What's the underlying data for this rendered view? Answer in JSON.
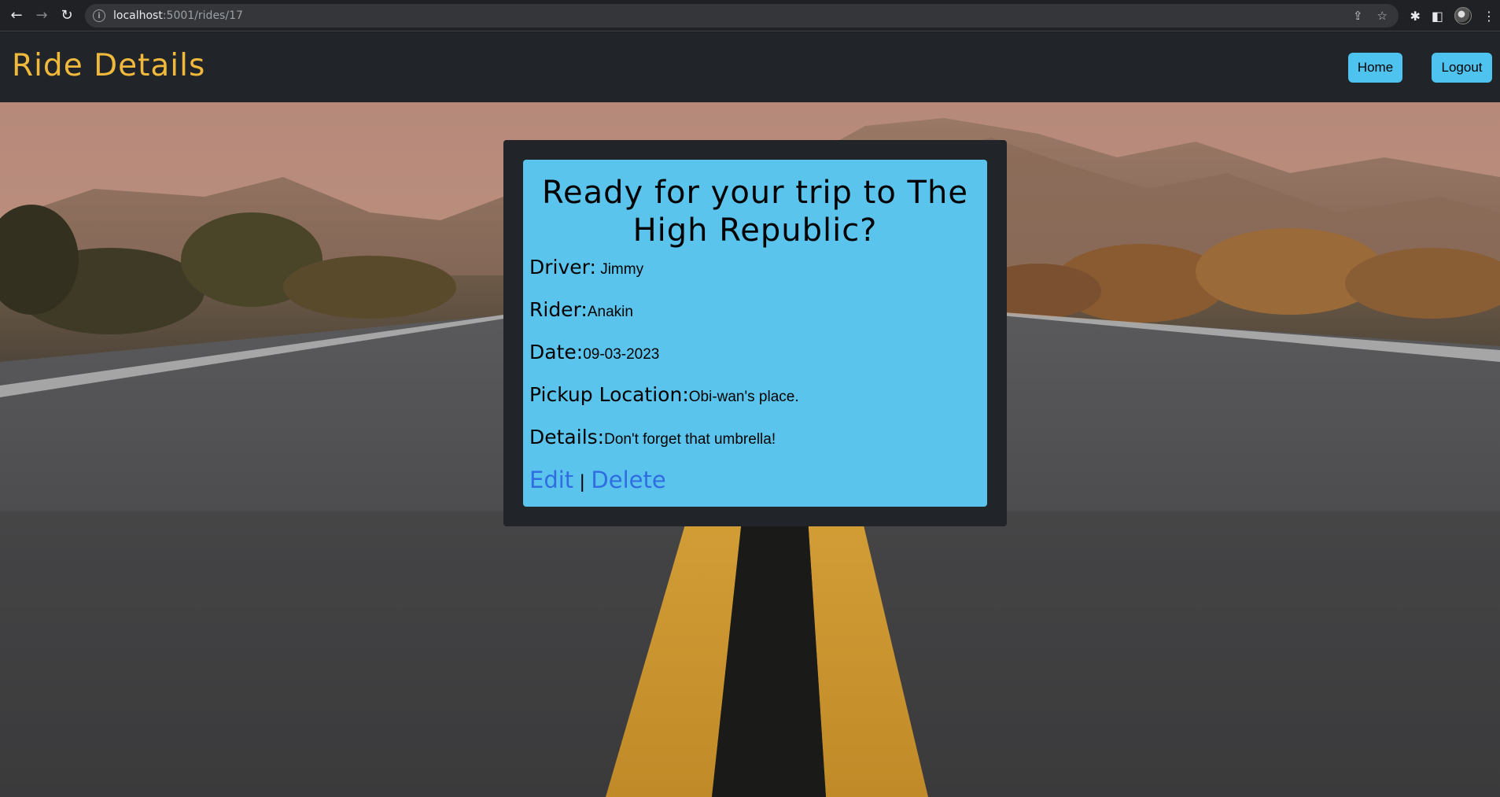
{
  "browser": {
    "url_host": "localhost",
    "url_path": ":5001/rides/17"
  },
  "header": {
    "title": "Ride Details",
    "home_label": "Home",
    "logout_label": "Logout"
  },
  "card": {
    "heading": "Ready for your trip to The High Republic?",
    "fields": [
      {
        "label": "Driver:",
        "value": " Jimmy"
      },
      {
        "label": "Rider:",
        "value": "Anakin"
      },
      {
        "label": "Date:",
        "value": "09-03-2023"
      },
      {
        "label": "Pickup Location:",
        "value": "Obi-wan's place."
      },
      {
        "label": "Details:",
        "value": "Don't forget that umbrella!"
      }
    ],
    "edit_label": "Edit",
    "separator": "|",
    "delete_label": "Delete"
  },
  "colors": {
    "title": "#f0b93c",
    "card": "#5bc4ec",
    "button": "#4fc3f0",
    "link": "#2f6de0",
    "header": "#212529"
  }
}
